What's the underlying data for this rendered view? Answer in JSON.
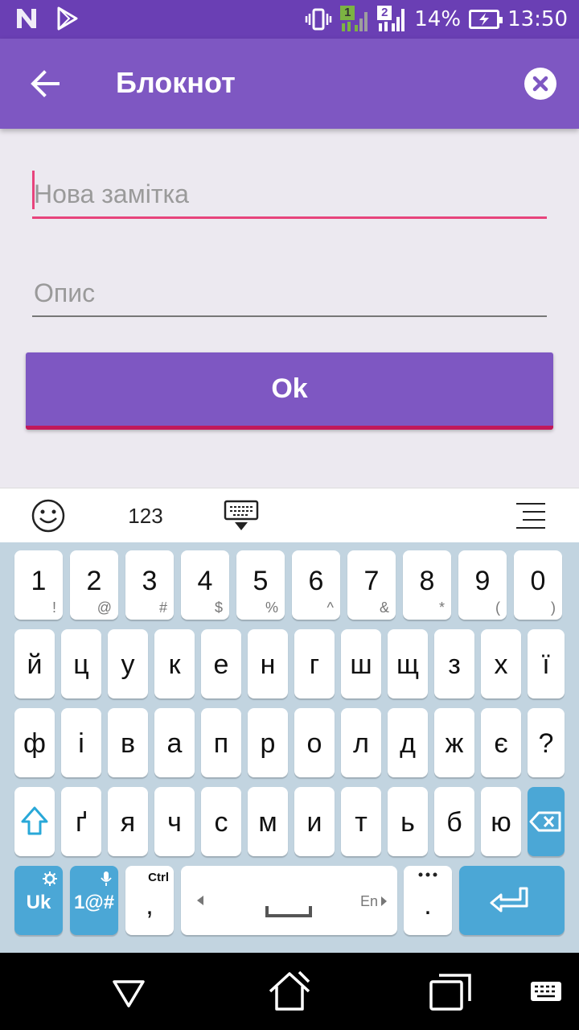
{
  "status_bar": {
    "battery": "14%",
    "time": "13:50",
    "sim1": "1",
    "sim2": "2",
    "icons": [
      "n-logo-icon",
      "play-store-icon",
      "vibrate-icon",
      "signal-sim1-icon",
      "signal-sim2-icon",
      "battery-charging-icon"
    ]
  },
  "app_bar": {
    "title": "Блокнот",
    "back_icon": "arrow-back-icon",
    "close_icon": "close-circle-icon"
  },
  "form": {
    "title_value": "",
    "title_placeholder": "Нова замітка",
    "desc_value": "",
    "desc_placeholder": "Опис",
    "ok_label": "Ok",
    "accent_color": "#7e57c2",
    "focus_color": "#e7447c"
  },
  "keyboard": {
    "toolbar": {
      "numbers_label": "123",
      "icons": [
        "emoji-icon",
        "keyboard-hide-icon",
        "menu-icon"
      ]
    },
    "number_row": [
      {
        "main": "1",
        "sub": "!"
      },
      {
        "main": "2",
        "sub": "@"
      },
      {
        "main": "3",
        "sub": "#"
      },
      {
        "main": "4",
        "sub": "$"
      },
      {
        "main": "5",
        "sub": "%"
      },
      {
        "main": "6",
        "sub": "^"
      },
      {
        "main": "7",
        "sub": "&"
      },
      {
        "main": "8",
        "sub": "*"
      },
      {
        "main": "9",
        "sub": "("
      },
      {
        "main": "0",
        "sub": ")"
      }
    ],
    "row1": [
      "й",
      "ц",
      "у",
      "к",
      "е",
      "н",
      "г",
      "ш",
      "щ",
      "з",
      "х",
      "ї"
    ],
    "row2": [
      "ф",
      "і",
      "в",
      "а",
      "п",
      "р",
      "о",
      "л",
      "д",
      "ж",
      "є",
      "?"
    ],
    "row3": [
      "ґ",
      "я",
      "ч",
      "с",
      "м",
      "и",
      "т",
      "ь",
      "б",
      "ю"
    ],
    "bottom": {
      "lang_label": "Uk",
      "symbols_label": "1@#",
      "ctrl_label": "Ctrl",
      "comma_label": ",",
      "space_lang_label": "En",
      "period_label": ".",
      "key_color": "#4ba7d6"
    }
  },
  "nav_bar": {
    "icons": [
      "back-triangle-icon",
      "home-icon",
      "recents-icon",
      "keyboard-switch-icon"
    ]
  }
}
